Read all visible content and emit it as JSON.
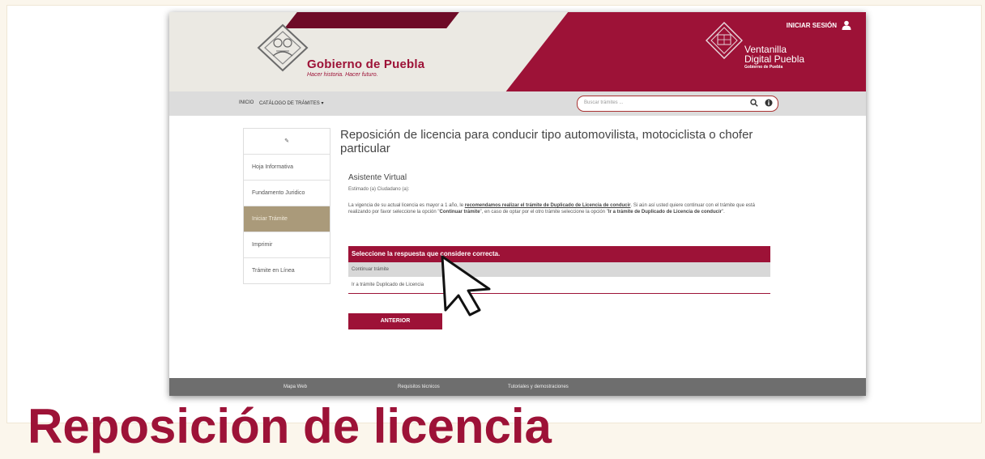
{
  "header": {
    "brand_title": "Gobierno de Puebla",
    "brand_subtitle": "Hacer historia. Hacer futuro.",
    "login_label": "INICIAR SESIÓN",
    "portal_line1": "Ventanilla",
    "portal_line2": "Digital Puebla",
    "portal_line3": "Gobierno de Puebla"
  },
  "nav": {
    "home": "INICIO",
    "catalog": "CATÁLOGO DE TRÁMITES ▾",
    "search_placeholder": "Buscar trámites ..."
  },
  "sidebar": {
    "items": [
      {
        "label": "✎"
      },
      {
        "label": "Hoja Informativa"
      },
      {
        "label": "Fundamento Juridico"
      },
      {
        "label": "Iniciar Trámite"
      },
      {
        "label": "Imprimir"
      },
      {
        "label": "Trámite en Línea"
      }
    ]
  },
  "main": {
    "title": "Reposición de licencia para conducir tipo automovilista, motociclista o chofer particular",
    "assistant_heading": "Asistente Virtual",
    "greeting": "Estimado (a) Ciudadano (a):",
    "paragraph_1": "La vigencia de su actual licencia es mayor a 1 año, le ",
    "paragraph_bold_1": "recomendamos realizar el trámite de Duplicado de Licencia de conducir",
    "paragraph_2": ". Si aún así usted quiere continuar con el trámite que está realizando por favor seleccione la opción \"",
    "paragraph_bold_2": "Continuar trámite",
    "paragraph_3": "\", en caso de optar por el otro trámite seleccione la opción \"",
    "paragraph_bold_3": "Ir a trámite de Duplicado de Licencia de conducir",
    "paragraph_4": "\".",
    "question_header": "Seleccione la respuesta que considere correcta.",
    "option_1": "Continuar trámite",
    "option_2": "Ir a trámite Duplicado de Licencia",
    "previous_button": "ANTERIOR"
  },
  "footer": {
    "items": [
      "Mapa Web",
      "Requisitos técnicos",
      "Tutoriales y demostraciones"
    ]
  },
  "overlay": {
    "heading": "Reposición de licencia"
  },
  "colors": {
    "brand": "#9d1237",
    "sidebar_active": "#aa9a7a",
    "footer": "#6e6e6e"
  }
}
